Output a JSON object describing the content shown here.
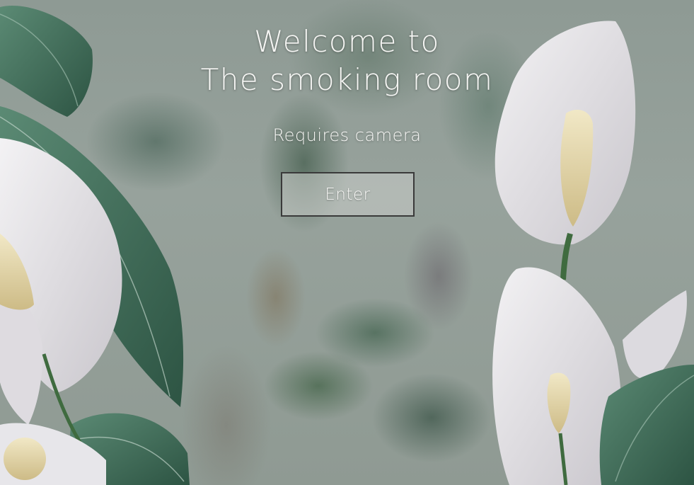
{
  "welcome": {
    "line1": "Welcome to",
    "line2": "The smoking room"
  },
  "subtitle": "Requires camera",
  "enter_button": {
    "label": "Enter"
  },
  "colors": {
    "text": "#f6f6f4",
    "button_border": "#3a3a3a",
    "leaf": "#3f6b57",
    "spathe": "#e9e7ea",
    "spadix": "#e8dcb4"
  }
}
